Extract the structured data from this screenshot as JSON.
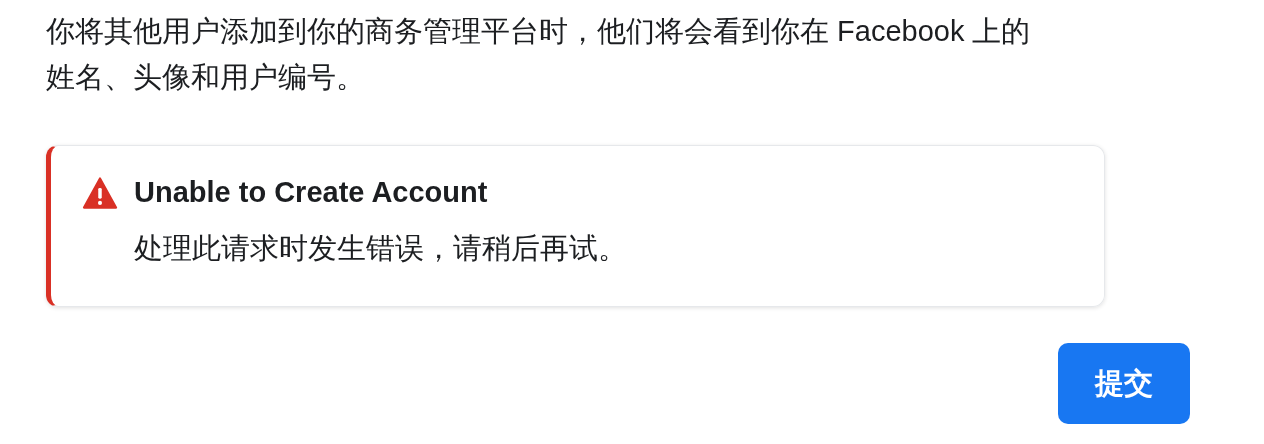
{
  "intro": "你将其他用户添加到你的商务管理平台时，他们将会看到你在 Facebook 上的姓名、头像和用户编号。",
  "alert": {
    "kind": "error",
    "title": "Unable to Create Account",
    "message": "处理此请求时发生错误，请稍后再试。"
  },
  "submit_button": "提交"
}
